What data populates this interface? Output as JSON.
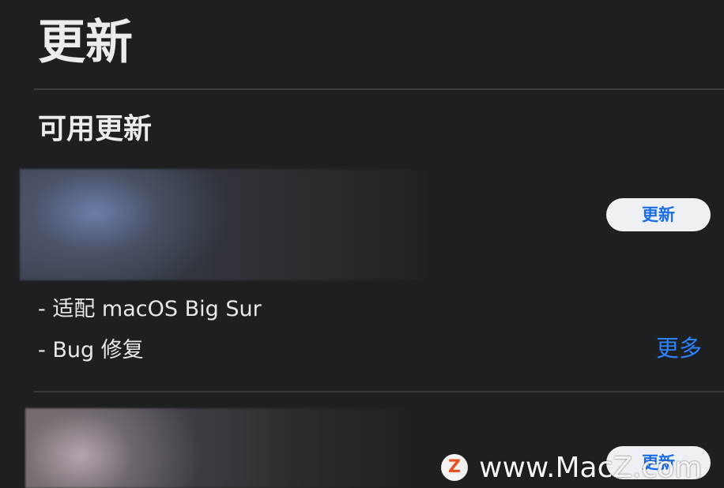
{
  "header": {
    "title": "更新"
  },
  "section": {
    "title": "可用更新"
  },
  "apps": [
    {
      "update_label": "更新",
      "notes": [
        "- 适配 macOS Big Sur",
        "- Bug 修复"
      ],
      "more_label": "更多"
    },
    {
      "update_label": "更新"
    }
  ],
  "watermark": {
    "logo_letter": "Z",
    "text": "www.MacZ.com"
  },
  "colors": {
    "background": "#1e1f20",
    "accent": "#2c82ff",
    "button_bg": "#eef0f4",
    "button_text": "#1c6ee8"
  }
}
